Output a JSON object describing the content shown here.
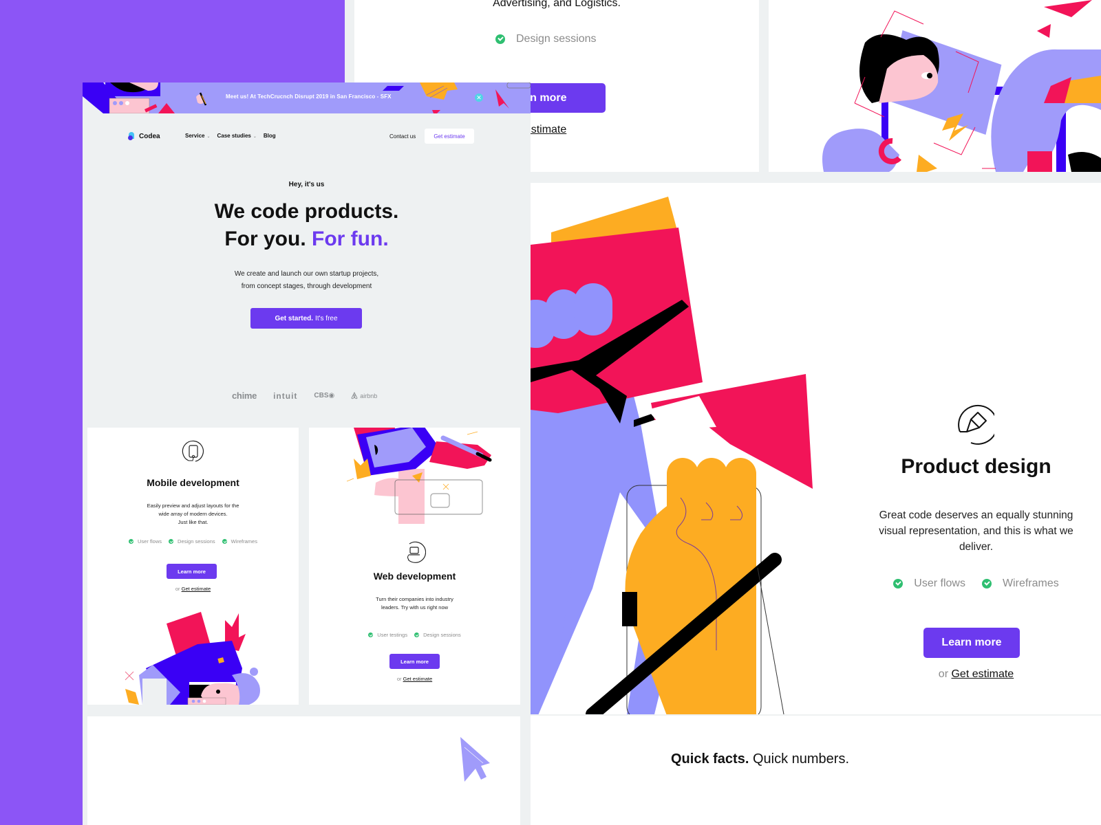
{
  "backdrop": {
    "accent": "#8c55f6"
  },
  "back_page": {
    "top_card": {
      "text_fragment": "Advertising, and Logistics.",
      "feature": "Design sessions",
      "learn_more_fragment": "arn more",
      "estimate_fragment": "et estimate"
    },
    "product_design": {
      "icon": "pencil-circle-icon",
      "title": "Product design",
      "description": "Great code deserves an equally stunning visual representation, and this is what we deliver.",
      "features": [
        "User flows",
        "Wireframes"
      ],
      "learn_more": "Learn more",
      "or_label": "or",
      "estimate_link": "Get estimate"
    },
    "quick_facts": {
      "bold": "Quick facts.",
      "rest": " Quick numbers."
    }
  },
  "front_page": {
    "banner": {
      "message": "Meet us! At TechCrucnch Disrupt 2019 in San Francisco - SFX",
      "close_icon": "close-icon"
    },
    "nav": {
      "logo": "Codea",
      "links": [
        {
          "label": "Service",
          "dropdown": true
        },
        {
          "label": "Case studies",
          "dropdown": true
        },
        {
          "label": "Blog",
          "dropdown": false
        }
      ],
      "contact": "Contact us",
      "estimate": "Get estimate"
    },
    "hero": {
      "eyebrow": "Hey, it's us",
      "title_line1": "We code products.",
      "title_line2_plain": "For you.",
      "title_line2_accent": "For fun.",
      "subtitle_line1": "We create and launch our own startup projects,",
      "subtitle_line2": "from concept stages, through development",
      "cta_bold": "Get started.",
      "cta_rest": "It's free"
    },
    "client_logos": [
      "chime",
      "intuit",
      "CBS",
      "airbnb"
    ],
    "cards": [
      {
        "icon": "mobile-phone-icon",
        "title": "Mobile development",
        "description_lines": [
          "Easily preview and adjust layouts for the",
          "wide array of modern devices.",
          "Just like that."
        ],
        "features": [
          "User flows",
          "Design sessions",
          "Wireframes"
        ],
        "learn_more": "Learn more",
        "or_label": "or",
        "estimate_link": "Get estimate"
      },
      {
        "icon": "laptop-icon",
        "title": "Web development",
        "description_lines": [
          "Turn their companies into industry",
          "leaders. Try with us right now"
        ],
        "features": [
          "User testings",
          "Design sessions"
        ],
        "learn_more": "Learn more",
        "or_label": "or",
        "estimate_link": "Get estimate"
      }
    ]
  },
  "colors": {
    "primary": "#6c3aef",
    "check": "#2fbf71",
    "illustration_lavender": "#a09bfa",
    "illustration_blue": "#3a00f5",
    "illustration_red": "#f21458",
    "illustration_yellow": "#fdac22",
    "illustration_pink": "#fcc5d1"
  }
}
